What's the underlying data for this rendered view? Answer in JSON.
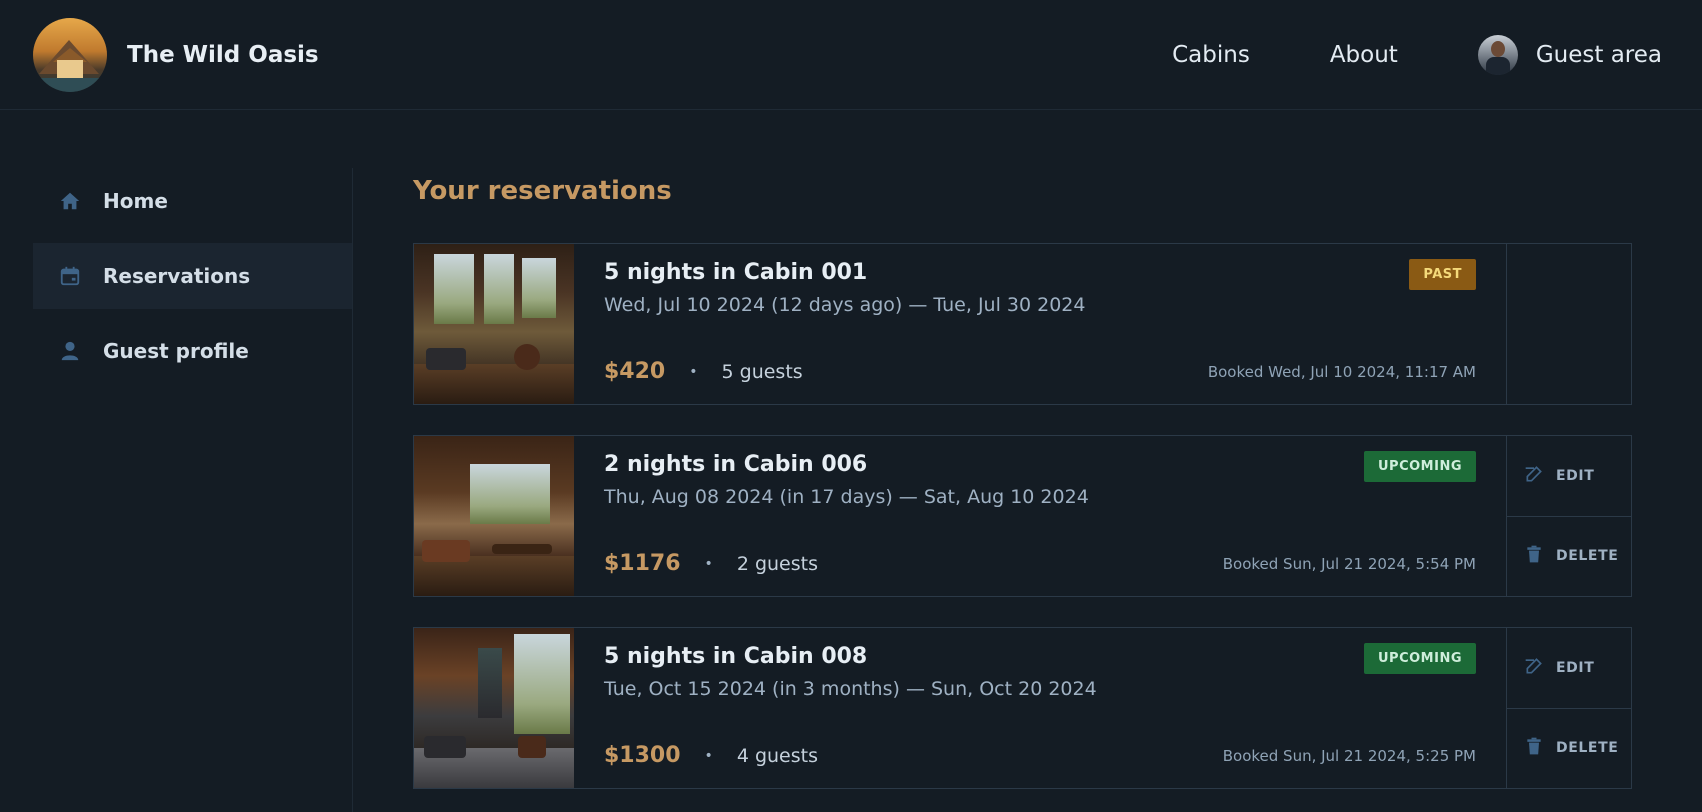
{
  "brand": {
    "name": "The Wild Oasis"
  },
  "nav": {
    "cabins": "Cabins",
    "about": "About",
    "guest_area": "Guest area"
  },
  "sidebar": {
    "items": [
      {
        "label": "Home",
        "icon": "home-icon"
      },
      {
        "label": "Reservations",
        "icon": "calendar-icon",
        "active": true
      },
      {
        "label": "Guest profile",
        "icon": "user-icon"
      }
    ]
  },
  "page": {
    "title": "Your reservations"
  },
  "reservations": [
    {
      "title": "5 nights in Cabin 001",
      "dates": "Wed, Jul 10 2024 (12 days ago) — Tue, Jul 30 2024",
      "price": "$420",
      "guests": "5 guests",
      "booked": "Booked Wed, Jul 10 2024, 11:17 AM",
      "status": "PAST"
    },
    {
      "title": "2 nights in Cabin 006",
      "dates": "Thu, Aug 08 2024 (in 17 days) — Sat, Aug 10 2024",
      "price": "$1176",
      "guests": "2 guests",
      "booked": "Booked Sun, Jul 21 2024, 5:54 PM",
      "status": "UPCOMING",
      "edit": "EDIT",
      "delete": "DELETE"
    },
    {
      "title": "5 nights in Cabin 008",
      "dates": "Tue, Oct 15 2024 (in 3 months) — Sun, Oct 20 2024",
      "price": "$1300",
      "guests": "4 guests",
      "booked": "Booked Sun, Jul 21 2024, 5:25 PM",
      "status": "UPCOMING",
      "edit": "EDIT",
      "delete": "DELETE"
    }
  ],
  "colors": {
    "accent": "#c69963",
    "past": "#8a5a14",
    "upcoming": "#1c6a37",
    "background": "#141c24"
  },
  "separator": "•"
}
